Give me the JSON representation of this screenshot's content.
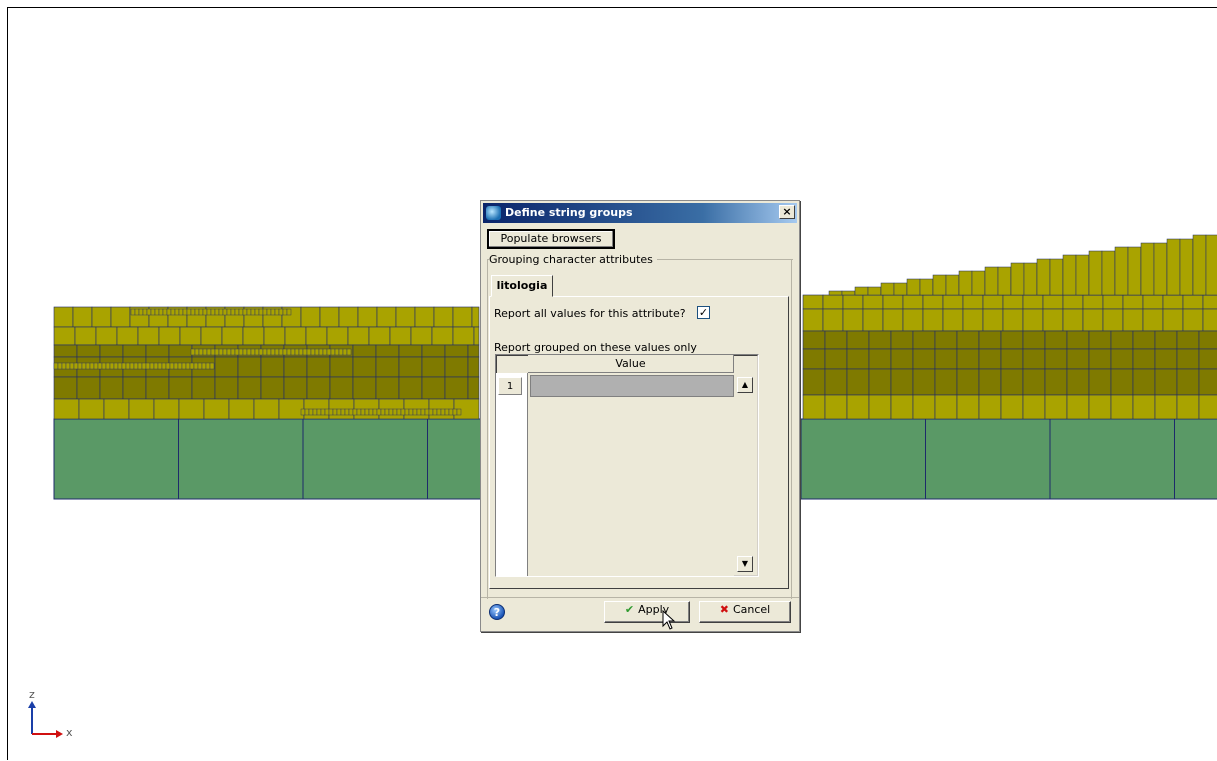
{
  "axis": {
    "z": "z",
    "x": "x"
  },
  "dialog": {
    "title": "Define string groups",
    "close_glyph": "×",
    "populate_button": "Populate browsers",
    "group_label": "Grouping character attributes",
    "tab_label": "litologia",
    "report_all_label": "Report all values for this attribute?",
    "report_all_checked": true,
    "report_grouped_label": "Report grouped on these values only",
    "grid": {
      "column_header": "Value",
      "rows": [
        {
          "num": "1",
          "value": ""
        }
      ]
    },
    "help_glyph": "?",
    "apply_label": "Apply",
    "cancel_label": "Cancel"
  },
  "colors": {
    "layer_yellow": "#a9a300",
    "layer_dark": "#7f7a00",
    "base_green": "#5a9966",
    "grid_line": "#1e2a6b"
  },
  "icons": [
    "dialog-app-icon",
    "close-icon",
    "checkbox-check-icon",
    "scroll-up-icon",
    "scroll-down-icon",
    "help-icon",
    "apply-check-icon",
    "cancel-x-icon",
    "mouse-cursor-icon"
  ]
}
